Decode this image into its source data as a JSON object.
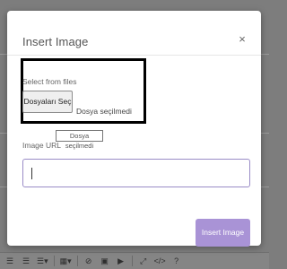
{
  "dialog": {
    "title": "Insert Image",
    "close_glyph": "×",
    "file_section_label": "Select from files",
    "file_button_label": "Dosyaları Seç",
    "file_status": "Dosya seçilmedi",
    "tooltip": "Dosya seçilmedi",
    "url_label": "Image URL",
    "url_value": "",
    "submit_label": "Insert Image"
  },
  "toolbar": {
    "items": [
      {
        "name": "unordered-list-icon",
        "glyph": "☰"
      },
      {
        "name": "ordered-list-icon",
        "glyph": "☰"
      },
      {
        "name": "paragraph-align-icon",
        "glyph": "☰▾"
      },
      {
        "name": "table-icon",
        "glyph": "▦▾"
      },
      {
        "name": "link-icon",
        "glyph": "⊘"
      },
      {
        "name": "picture-icon",
        "glyph": "▣"
      },
      {
        "name": "video-icon",
        "glyph": "▶"
      },
      {
        "name": "fullscreen-icon",
        "glyph": "⤢"
      },
      {
        "name": "code-view-icon",
        "glyph": "</>"
      },
      {
        "name": "help-icon",
        "glyph": "?"
      }
    ]
  },
  "colors": {
    "accent": "#a993d6",
    "input_border": "#9a8cc7",
    "overlay": "#7d7d7d"
  }
}
